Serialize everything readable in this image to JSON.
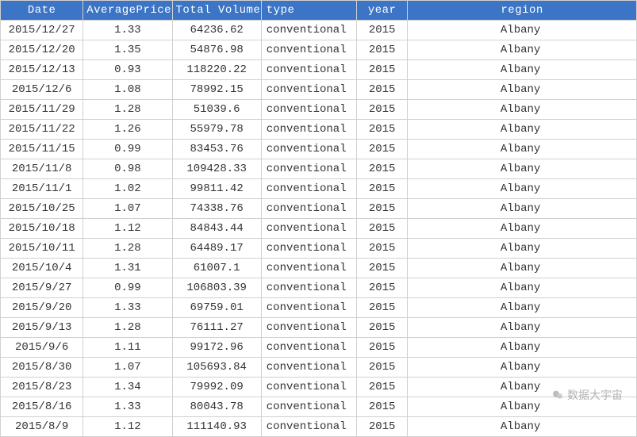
{
  "columns": {
    "date": "Date",
    "price": "AveragePrice",
    "volume": "Total Volume",
    "type": "type",
    "year": "year",
    "region": "region"
  },
  "rows": [
    {
      "date": "2015/12/27",
      "price": "1.33",
      "volume": "64236.62",
      "type": "conventional",
      "year": "2015",
      "region": "Albany"
    },
    {
      "date": "2015/12/20",
      "price": "1.35",
      "volume": "54876.98",
      "type": "conventional",
      "year": "2015",
      "region": "Albany"
    },
    {
      "date": "2015/12/13",
      "price": "0.93",
      "volume": "118220.22",
      "type": "conventional",
      "year": "2015",
      "region": "Albany"
    },
    {
      "date": "2015/12/6",
      "price": "1.08",
      "volume": "78992.15",
      "type": "conventional",
      "year": "2015",
      "region": "Albany"
    },
    {
      "date": "2015/11/29",
      "price": "1.28",
      "volume": "51039.6",
      "type": "conventional",
      "year": "2015",
      "region": "Albany"
    },
    {
      "date": "2015/11/22",
      "price": "1.26",
      "volume": "55979.78",
      "type": "conventional",
      "year": "2015",
      "region": "Albany"
    },
    {
      "date": "2015/11/15",
      "price": "0.99",
      "volume": "83453.76",
      "type": "conventional",
      "year": "2015",
      "region": "Albany"
    },
    {
      "date": "2015/11/8",
      "price": "0.98",
      "volume": "109428.33",
      "type": "conventional",
      "year": "2015",
      "region": "Albany"
    },
    {
      "date": "2015/11/1",
      "price": "1.02",
      "volume": "99811.42",
      "type": "conventional",
      "year": "2015",
      "region": "Albany"
    },
    {
      "date": "2015/10/25",
      "price": "1.07",
      "volume": "74338.76",
      "type": "conventional",
      "year": "2015",
      "region": "Albany"
    },
    {
      "date": "2015/10/18",
      "price": "1.12",
      "volume": "84843.44",
      "type": "conventional",
      "year": "2015",
      "region": "Albany"
    },
    {
      "date": "2015/10/11",
      "price": "1.28",
      "volume": "64489.17",
      "type": "conventional",
      "year": "2015",
      "region": "Albany"
    },
    {
      "date": "2015/10/4",
      "price": "1.31",
      "volume": "61007.1",
      "type": "conventional",
      "year": "2015",
      "region": "Albany"
    },
    {
      "date": "2015/9/27",
      "price": "0.99",
      "volume": "106803.39",
      "type": "conventional",
      "year": "2015",
      "region": "Albany"
    },
    {
      "date": "2015/9/20",
      "price": "1.33",
      "volume": "69759.01",
      "type": "conventional",
      "year": "2015",
      "region": "Albany"
    },
    {
      "date": "2015/9/13",
      "price": "1.28",
      "volume": "76111.27",
      "type": "conventional",
      "year": "2015",
      "region": "Albany"
    },
    {
      "date": "2015/9/6",
      "price": "1.11",
      "volume": "99172.96",
      "type": "conventional",
      "year": "2015",
      "region": "Albany"
    },
    {
      "date": "2015/8/30",
      "price": "1.07",
      "volume": "105693.84",
      "type": "conventional",
      "year": "2015",
      "region": "Albany"
    },
    {
      "date": "2015/8/23",
      "price": "1.34",
      "volume": "79992.09",
      "type": "conventional",
      "year": "2015",
      "region": "Albany"
    },
    {
      "date": "2015/8/16",
      "price": "1.33",
      "volume": "80043.78",
      "type": "conventional",
      "year": "2015",
      "region": "Albany"
    },
    {
      "date": "2015/8/9",
      "price": "1.12",
      "volume": "111140.93",
      "type": "conventional",
      "year": "2015",
      "region": "Albany"
    }
  ],
  "watermark": "数据大宇宙"
}
